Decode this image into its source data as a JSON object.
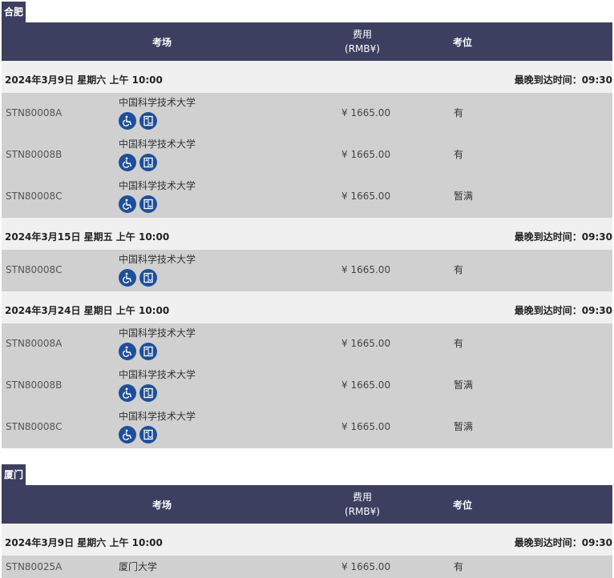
{
  "header": {
    "venue_label": "考场",
    "fee_label": "费用",
    "fee_unit": "(RMB¥)",
    "seat_label": "考位"
  },
  "cities": [
    {
      "name": "合肥",
      "days": [
        {
          "date": "2024年3月9日 星期六 上午 10:00",
          "latest": "最晚到达时间：09:30",
          "rows": [
            {
              "code": "STN80008A",
              "venue": "中国科学技术大学",
              "fee": "¥ 1665.00",
              "seat": "有"
            },
            {
              "code": "STN80008B",
              "venue": "中国科学技术大学",
              "fee": "¥ 1665.00",
              "seat": "有"
            },
            {
              "code": "STN80008C",
              "venue": "中国科学技术大学",
              "fee": "¥ 1665.00",
              "seat": "暂满"
            }
          ]
        },
        {
          "date": "2024年3月15日 星期五 上午 10:00",
          "latest": "最晚到达时间：09:30",
          "rows": [
            {
              "code": "STN80008C",
              "venue": "中国科学技术大学",
              "fee": "¥ 1665.00",
              "seat": "有"
            }
          ]
        },
        {
          "date": "2024年3月24日 星期日 上午 10:00",
          "latest": "最晚到达时间：09:30",
          "rows": [
            {
              "code": "STN80008A",
              "venue": "中国科学技术大学",
              "fee": "¥ 1665.00",
              "seat": "有"
            },
            {
              "code": "STN80008B",
              "venue": "中国科学技术大学",
              "fee": "¥ 1665.00",
              "seat": "暂满"
            },
            {
              "code": "STN80008C",
              "venue": "中国科学技术大学",
              "fee": "¥ 1665.00",
              "seat": "暂满"
            }
          ]
        }
      ]
    },
    {
      "name": "厦门",
      "days": [
        {
          "date": "2024年3月9日 星期六 上午 10:00",
          "latest": "最晚到达时间：09:30",
          "rows": [
            {
              "code": "STN80025A",
              "venue": "厦门大学",
              "fee": "¥ 1665.00",
              "seat": "有"
            }
          ]
        }
      ]
    }
  ],
  "icons": {
    "accessibility": "wheelchair-icon",
    "elevator": "elevator-icon",
    "accent": "#1e4f9a",
    "header_bg": "#3c3f5f"
  }
}
